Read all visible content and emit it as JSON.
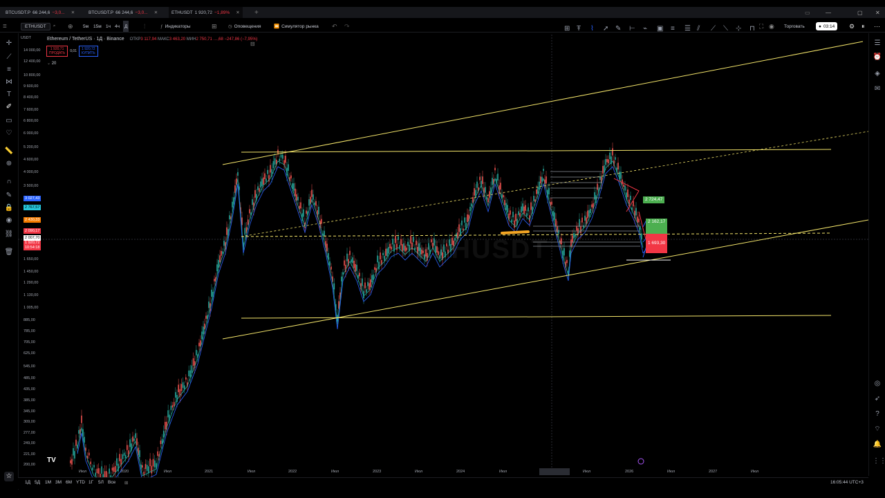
{
  "tabs": [
    {
      "symbol": "BTCUSDT.P",
      "price": "66 244,6",
      "change": "−3,0..."
    },
    {
      "symbol": "BTCUSDT.P",
      "price": "66 244,6",
      "change": "−3,0..."
    },
    {
      "symbol": "ETHUSDT",
      "price": "1 920,72",
      "change": "−1,89%"
    }
  ],
  "toolbar": {
    "symbol": "ETHUSDT",
    "intervals": [
      "5м",
      "15м",
      "1ч",
      "4ч",
      "Д"
    ],
    "indicators": "Индикаторы",
    "alerts": "Оповещения",
    "replay": "Симулятор рынка",
    "trade": "Торговать",
    "record_time": "03:14"
  },
  "legend": {
    "title": "Ethereum / TetherUS · 1Д · Binance",
    "open_label": "ОТКР",
    "open_val": "3 117,94",
    "high_label": "МАКС",
    "high_val": "3 463,20",
    "low_label": "МИН",
    "low_val": "2 750,71",
    "close_fragment": "…,68",
    "change": "−247,86 (−7,95%)",
    "sell_price": "1 920,71",
    "sell_label": "ПРОДАТЬ",
    "spread": "0,01",
    "buy_price": "1 920,72",
    "buy_label": "КУПИТЬ",
    "vol_label": "20"
  },
  "chart": {
    "symbol_corner": "USDT",
    "watermark": "ETHUSDT",
    "y_labels": [
      "14 000,00",
      "12 400,00",
      "10 800,00",
      "9 600,00",
      "8 400,00",
      "7 600,00",
      "6 800,00",
      "6 000,00",
      "5 200,00",
      "4 600,00",
      "4 000,00",
      "3 500,00",
      "3 027,43",
      "2 767,57",
      "2 430,33",
      "2 090,17",
      "2 007,70",
      "1 920,72",
      "1 650,00",
      "1 450,00",
      "1 290,00",
      "1 130,00",
      "1 005,00",
      "885,00",
      "785,00",
      "705,00",
      "625,00",
      "545,00",
      "485,00",
      "435,00",
      "385,00",
      "345,00",
      "309,00",
      "277,00",
      "249,00",
      "221,00",
      "200,00"
    ],
    "x_labels": [
      "Июл",
      "2020",
      "Июл",
      "2021",
      "Июл",
      "2022",
      "Июл",
      "2023",
      "Июл",
      "2024",
      "Июл",
      "Чт 02 Фев '25",
      "Июл",
      "2026",
      "Июл",
      "2027",
      "Июл"
    ],
    "boxes": {
      "upper": "2 724,47",
      "mid": "2 162,17",
      "low": "1 693,30"
    },
    "countdown": "10:54:18",
    "clock": "16:05:44 UTC+3"
  },
  "bottom": {
    "ranges": [
      "1Д",
      "5Д",
      "1М",
      "3М",
      "6М",
      "YTD",
      "1Г",
      "5Л",
      "Все"
    ]
  },
  "colors": {
    "up": "#26a69a",
    "down": "#ef5350",
    "trend": "#f5e66b",
    "accent": "#2962ff"
  }
}
